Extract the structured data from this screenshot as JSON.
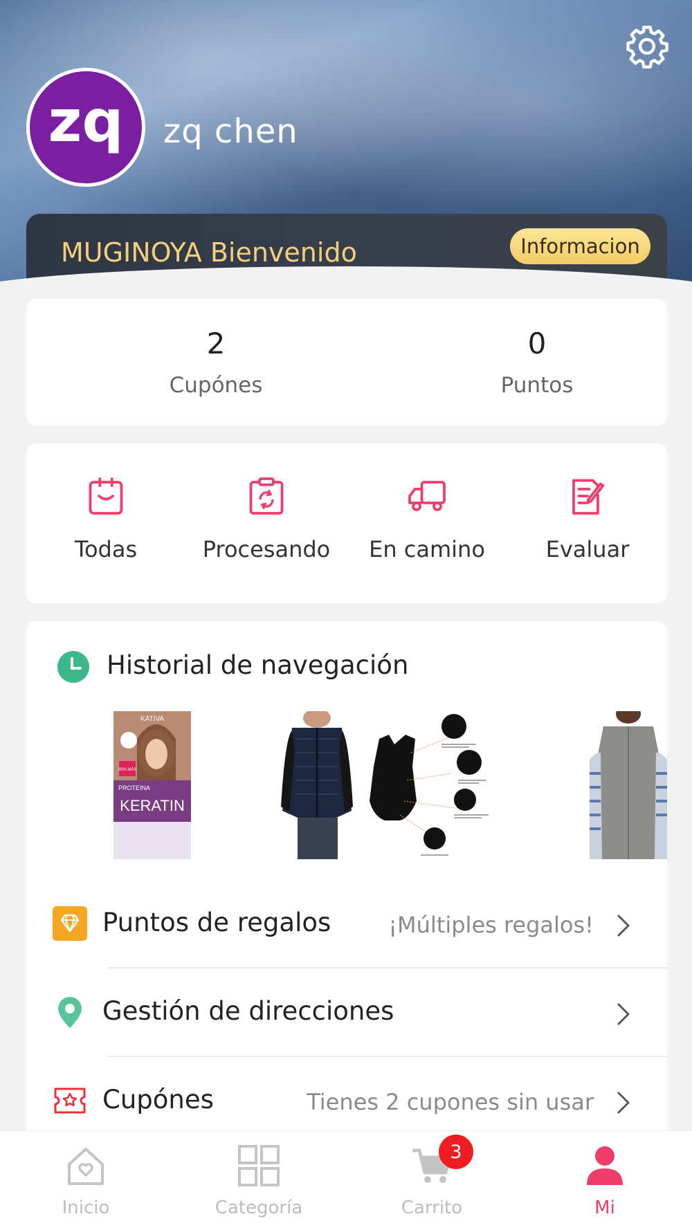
{
  "header": {
    "avatar_initials": "zq",
    "username": "zq chen",
    "welcome_text": "MUGINOYA Bienvenido",
    "info_button": "Informacion"
  },
  "stats": [
    {
      "value": "2",
      "label": "Cupónes"
    },
    {
      "value": "0",
      "label": "Puntos"
    }
  ],
  "orders": [
    {
      "label": "Todas",
      "icon": "clipboard-smile-icon"
    },
    {
      "label": "Procesando",
      "icon": "clipboard-refresh-icon"
    },
    {
      "label": "En camino",
      "icon": "truck-icon"
    },
    {
      "label": "Evaluar",
      "icon": "edit-document-icon"
    }
  ],
  "history": {
    "title": "Historial de navegación",
    "thumbnails": [
      {
        "box_brand": "KATIVA",
        "box_badge": "50% MÁS",
        "box_line1": "PROTEINA",
        "box_line2": "KERATIN"
      },
      {
        "kind": "navy-vest"
      },
      {
        "kind": "black-compression-vest"
      },
      {
        "kind": "grey-fleece-vest"
      }
    ]
  },
  "menu": [
    {
      "title": "Puntos de regalos",
      "hint": "¡Múltiples regalos!",
      "icon": "gift-diamond-icon"
    },
    {
      "title": "Gestión de direcciones",
      "hint": "",
      "icon": "location-pin-icon"
    },
    {
      "title": "Cupónes",
      "hint": "Tienes 2 cupones sin usar",
      "icon": "coupon-icon"
    }
  ],
  "tabbar": {
    "items": [
      {
        "label": "Inicio",
        "icon": "home-icon",
        "active": false
      },
      {
        "label": "Categoría",
        "icon": "category-grid-icon",
        "active": false
      },
      {
        "label": "Carrito",
        "icon": "cart-icon",
        "active": false
      },
      {
        "label": "Mi",
        "icon": "user-icon",
        "active": true
      }
    ],
    "cart_badge": "3"
  },
  "colors": {
    "accent": "#ef3d6b",
    "welcome_gold": "#f4cf7e",
    "avatar_purple": "#7a1fa2",
    "history_green": "#3cb88a",
    "gift_orange": "#f5a623",
    "badge_red": "#f11c22"
  }
}
